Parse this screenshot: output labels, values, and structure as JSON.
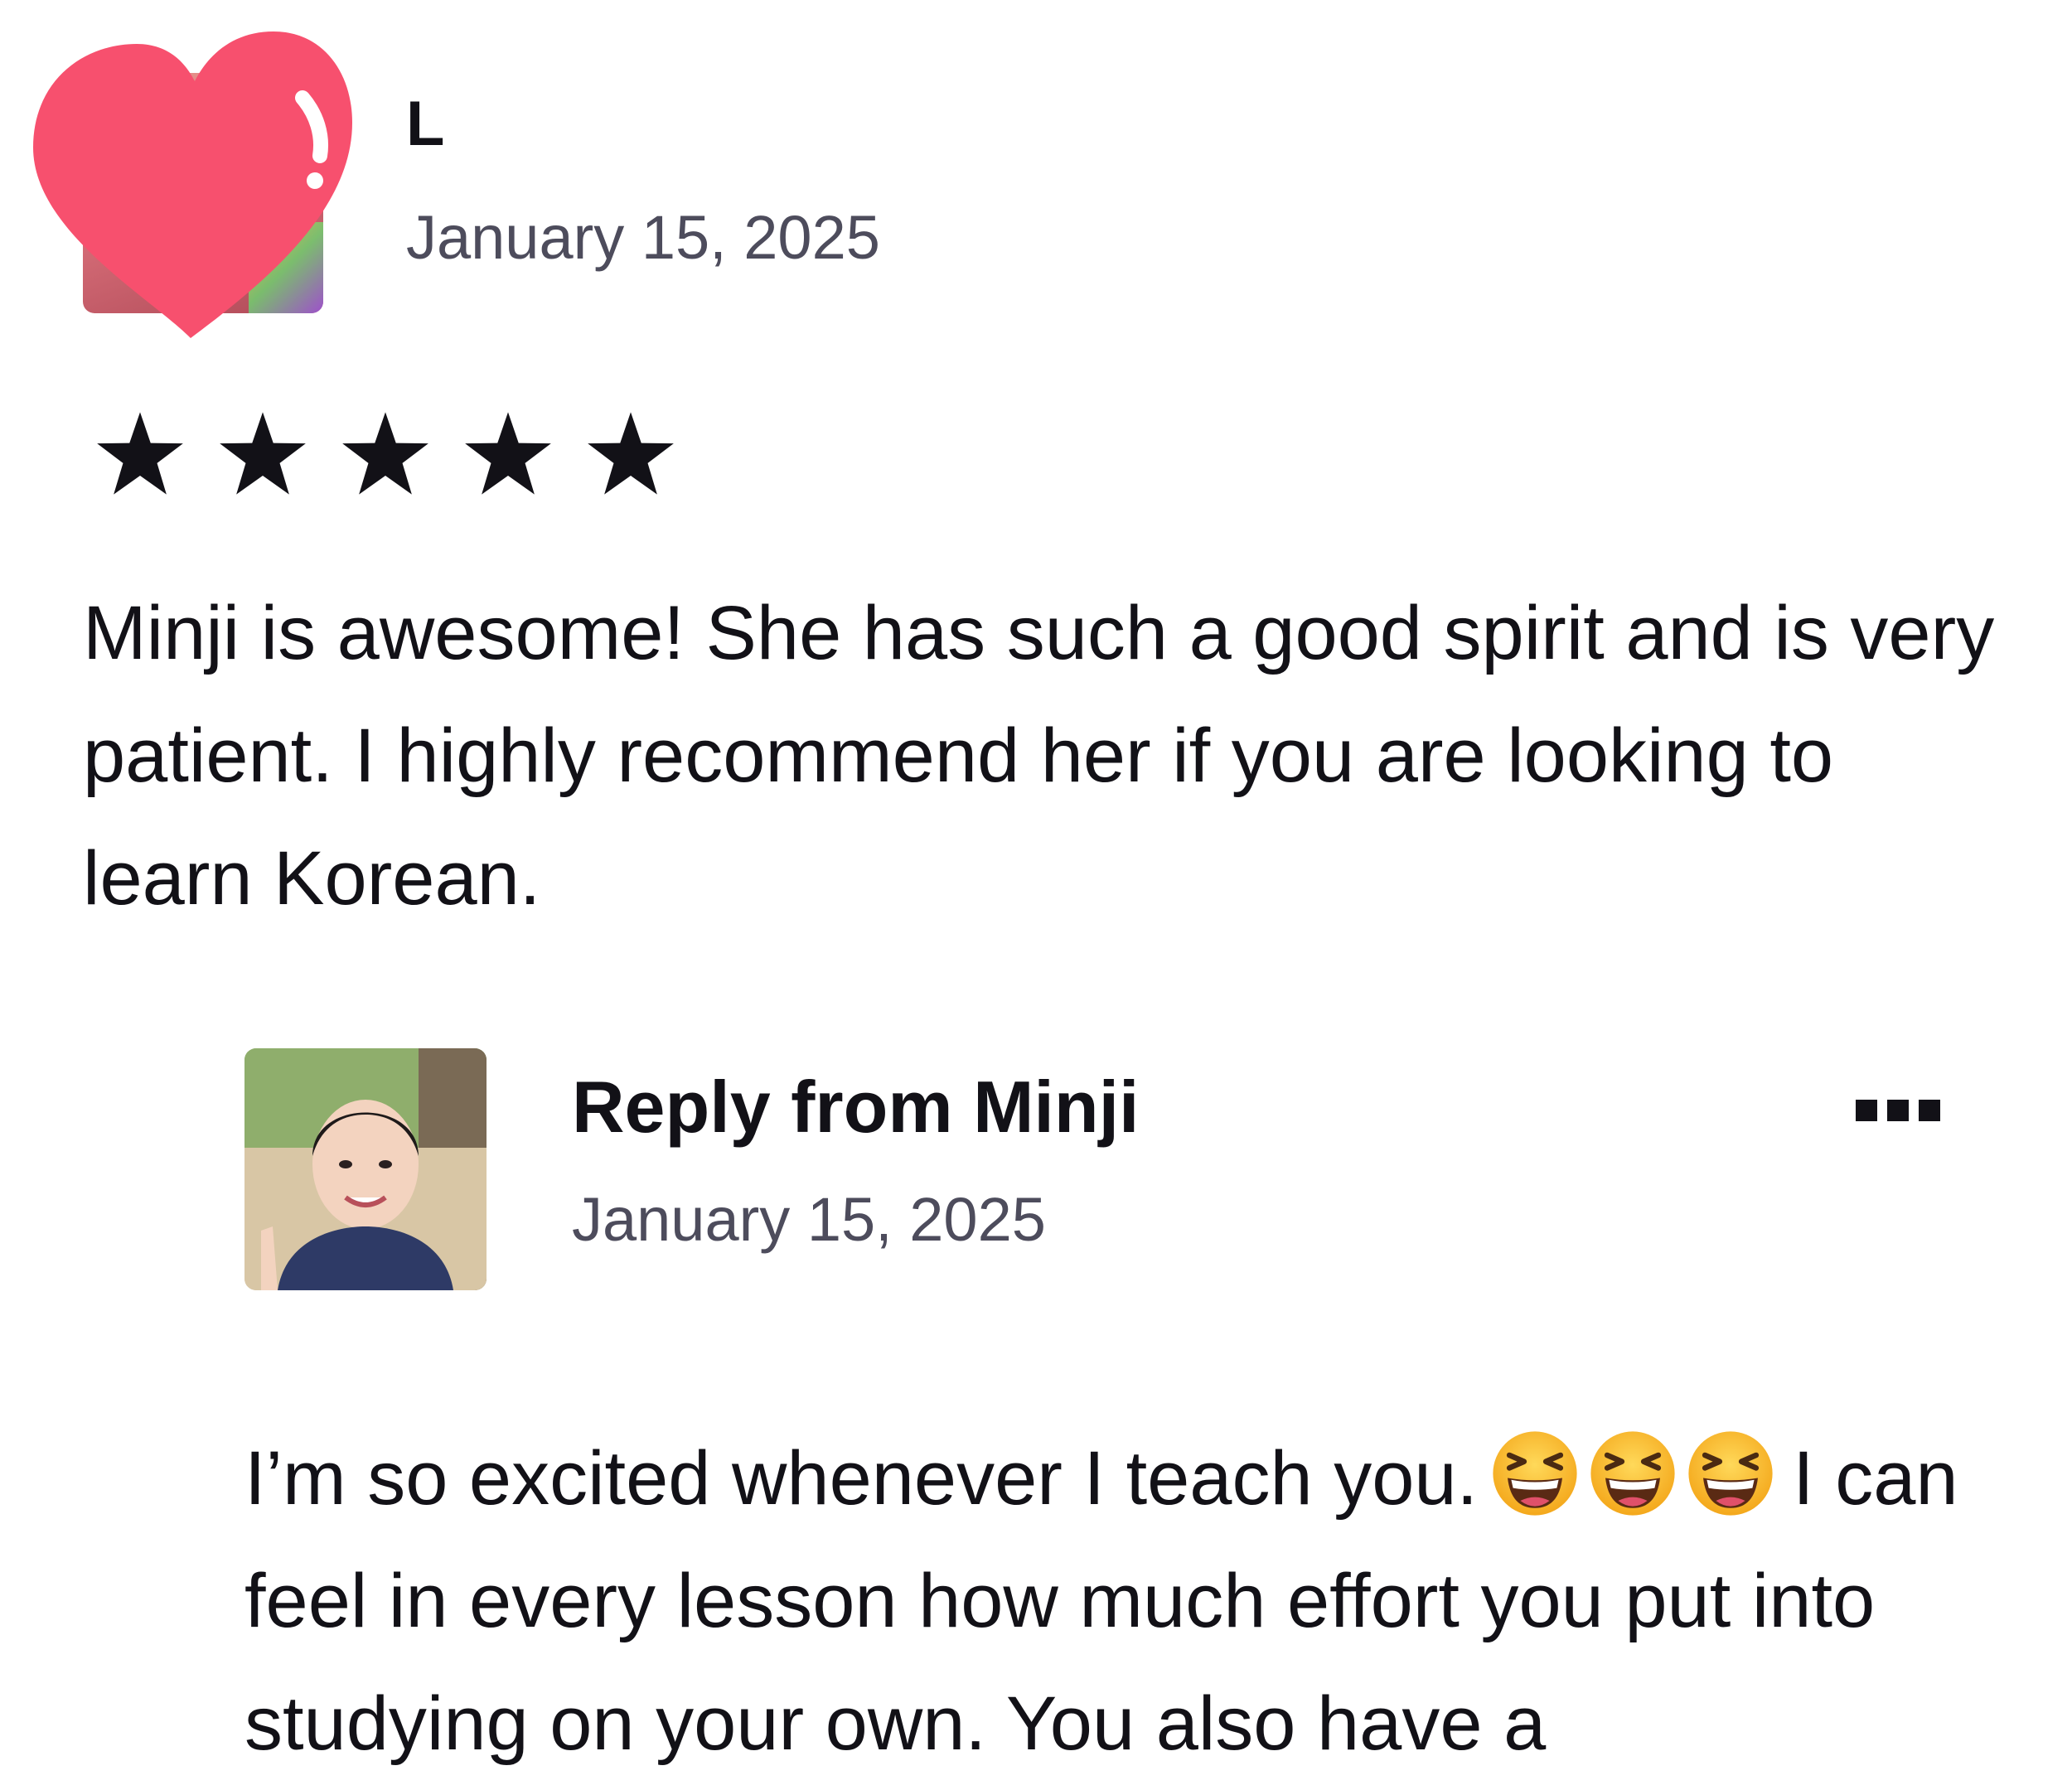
{
  "review": {
    "reviewer_name": "L",
    "date": "January 15, 2025",
    "rating": 5,
    "rating_max": 5,
    "text": "Minji is awesome! She has such a good spirit and is very patient. I highly recommend her if you are looking to learn Korean."
  },
  "reply": {
    "title": "Reply from Minji",
    "date": "January 15, 2025",
    "text_before_emoji": "I’m so excited whenever I teach you.",
    "emoji": "grinning-squinting-face",
    "emoji_count": 3,
    "text_after_emoji": "I can feel in every lesson how much effort you put into studying on your own. You also have a"
  },
  "icons": {
    "heart": "heart-icon",
    "star": "star-icon",
    "more": "more-options-icon"
  },
  "colors": {
    "heart": "#f7506e",
    "star": "#121117",
    "text": "#121117",
    "muted": "#4d4c5c"
  }
}
